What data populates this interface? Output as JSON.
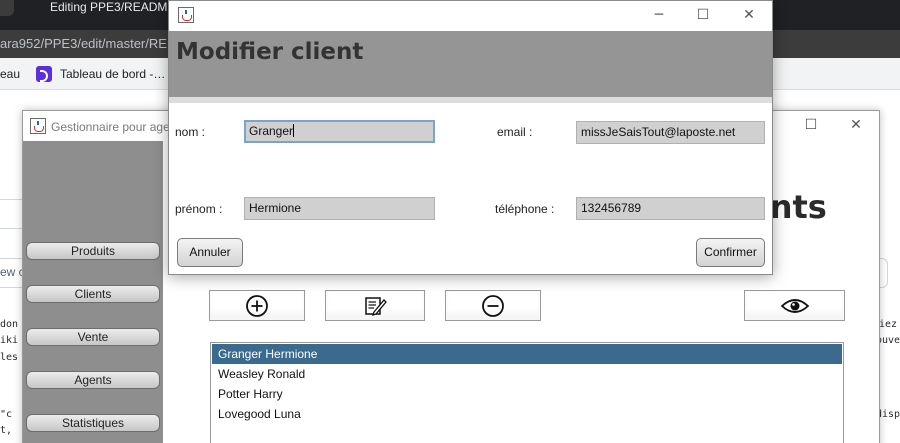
{
  "browser": {
    "tab_title": "Editing PPE3/READMD",
    "url": "ara952/PPE3/edit/master/RE",
    "bookmark_fragment": "eau",
    "bookmark_label": "Tableau de bord -…"
  },
  "page_fragments": {
    "left_1": "don",
    "left_2": "iki",
    "left_3": "les",
    "left_4": "\"c",
    "left_5": "t,",
    "right_1": "iez",
    "right_2": "ouve",
    "right_3": "disp",
    "left_view": "ew c"
  },
  "gestionnaire": {
    "title": "Gestionnaire pour age",
    "sidebar": [
      {
        "label": "Produits"
      },
      {
        "label": "Clients"
      },
      {
        "label": "Vente"
      },
      {
        "label": "Agents"
      },
      {
        "label": "Statistiques"
      }
    ],
    "big_title_fragment": "ents",
    "toolbar": {
      "add_icon": "plus-circle-icon",
      "edit_icon": "edit-note-icon",
      "remove_icon": "minus-circle-icon",
      "view_icon": "eye-icon"
    },
    "clients": [
      {
        "name": "Granger Hermione",
        "selected": true
      },
      {
        "name": "Weasley Ronald",
        "selected": false
      },
      {
        "name": "Potter Harry",
        "selected": false
      },
      {
        "name": "Lovegood Luna",
        "selected": false
      }
    ]
  },
  "dialog": {
    "header_title": "Modifier client",
    "window_controls": {
      "minimize": "─",
      "maximize": "☐",
      "close": "✕"
    },
    "fields": {
      "nom": {
        "label": "nom :",
        "value": "Granger"
      },
      "prenom": {
        "label": "prénom :",
        "value": "Hermione"
      },
      "email": {
        "label": "email :",
        "value": "missJeSaisTout@laposte.net"
      },
      "telephone": {
        "label": "téléphone :",
        "value": "132456789"
      }
    },
    "buttons": {
      "cancel": "Annuler",
      "confirm": "Confirmer"
    }
  },
  "colors": {
    "dialog_header": "#959595",
    "sidebar": "#8e8e8e",
    "selection": "#3b6a8f",
    "field_bg": "#d0d0d0",
    "focus_border": "#7ba4cd"
  }
}
